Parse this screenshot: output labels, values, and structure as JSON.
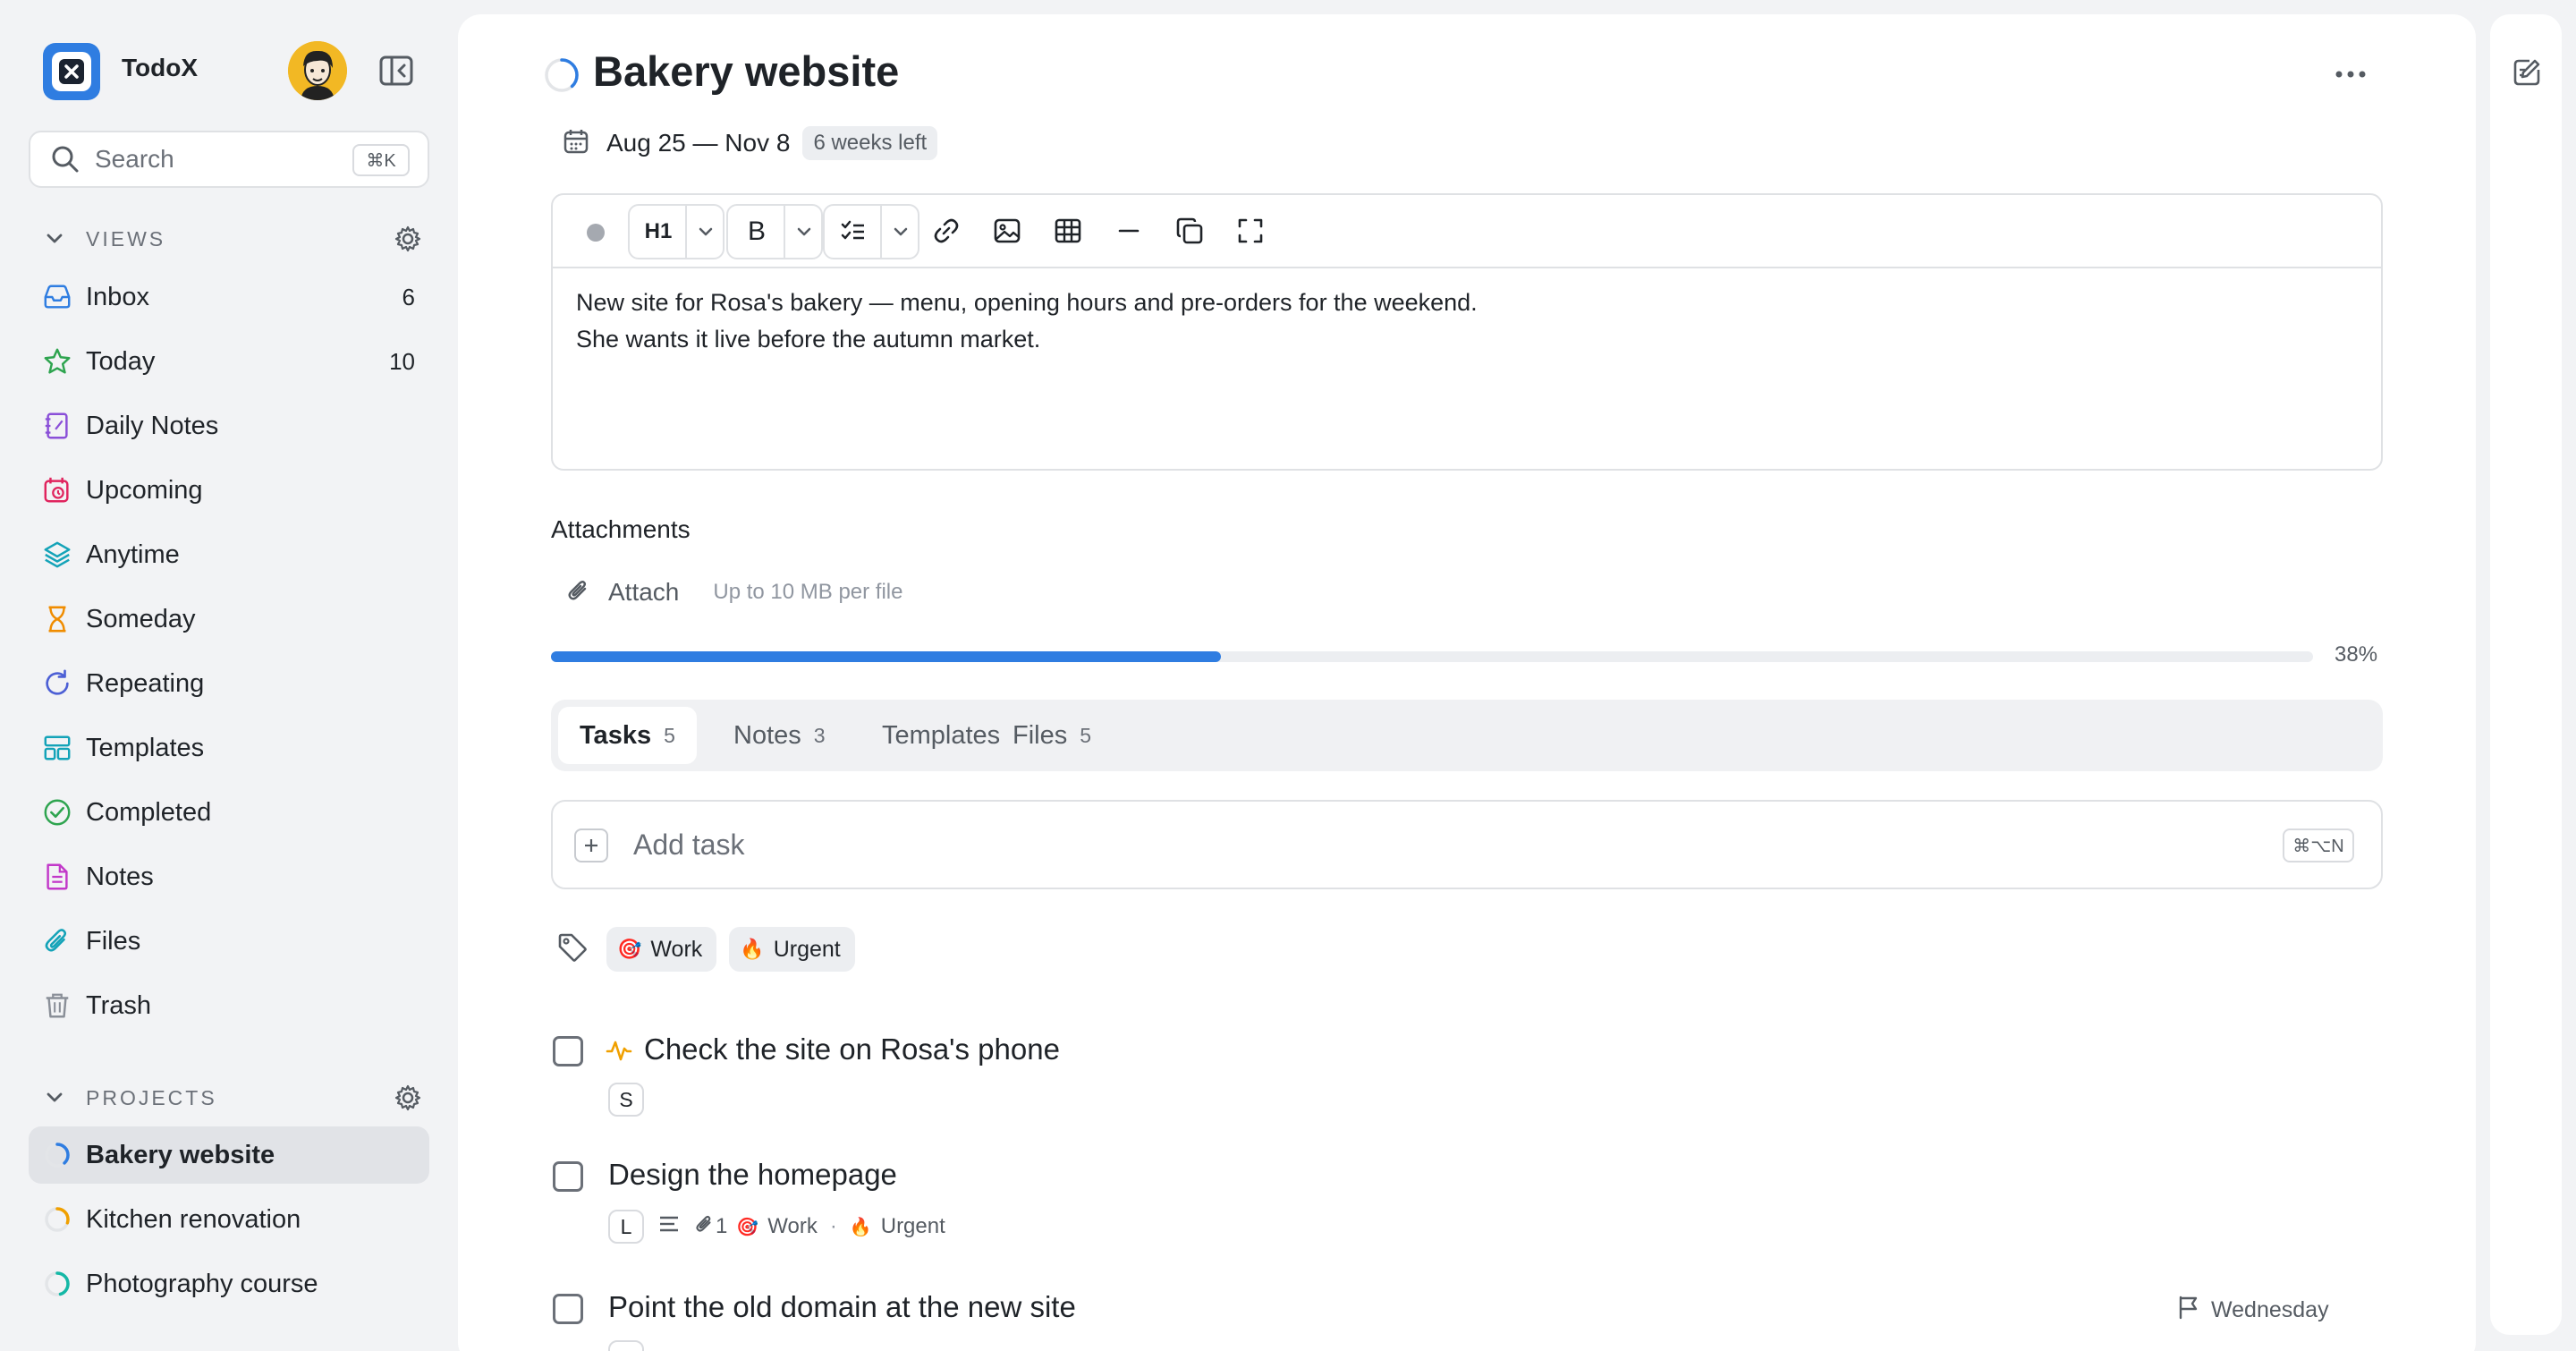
{
  "app": {
    "name": "TodoX"
  },
  "search": {
    "label": "Search",
    "shortcut": "⌘K"
  },
  "views": {
    "header": "VIEWS",
    "items": [
      {
        "label": "Inbox",
        "count": "6",
        "icon": "inbox-icon",
        "color": "#2f7de1"
      },
      {
        "label": "Today",
        "count": "10",
        "icon": "star-icon",
        "color": "#2ea44f"
      },
      {
        "label": "Daily Notes",
        "count": "",
        "icon": "notebook-icon",
        "color": "#8a4fd8"
      },
      {
        "label": "Upcoming",
        "count": "",
        "icon": "calendar-clock-icon",
        "color": "#e0245e"
      },
      {
        "label": "Anytime",
        "count": "",
        "icon": "layers-icon",
        "color": "#14a3b8"
      },
      {
        "label": "Someday",
        "count": "",
        "icon": "hourglass-icon",
        "color": "#f08c00"
      },
      {
        "label": "Repeating",
        "count": "",
        "icon": "repeat-icon",
        "color": "#4c5fd5"
      },
      {
        "label": "Templates",
        "count": "",
        "icon": "template-icon",
        "color": "#14a3b8"
      },
      {
        "label": "Completed",
        "count": "",
        "icon": "check-circle-icon",
        "color": "#2ea44f"
      },
      {
        "label": "Notes",
        "count": "",
        "icon": "note-icon",
        "color": "#c238c9"
      },
      {
        "label": "Files",
        "count": "",
        "icon": "paperclip-icon",
        "color": "#14a3b8"
      },
      {
        "label": "Trash",
        "count": "",
        "icon": "trash-icon",
        "color": "#8a8f98"
      }
    ]
  },
  "projects": {
    "header": "PROJECTS",
    "items": [
      {
        "label": "Bakery website",
        "progress": 0.38,
        "color": "#2f7de1",
        "active": true
      },
      {
        "label": "Kitchen renovation",
        "progress": 0.3,
        "color": "#f0a000",
        "active": false
      },
      {
        "label": "Photography course",
        "progress": 0.45,
        "color": "#14b8a6",
        "active": false
      }
    ]
  },
  "project": {
    "title": "Bakery website",
    "progress": 0.38,
    "date_range": "Aug 25 — Nov 8",
    "time_left": "6 weeks left",
    "toolbar": {
      "heading": "H1",
      "bold": "B"
    },
    "description": [
      "New site for Rosa's bakery — menu, opening hours and pre-orders for the weekend.",
      "She wants it live before the autumn market."
    ]
  },
  "attachments": {
    "title": "Attachments",
    "button": "Attach",
    "hint": "Up to 10 MB per file"
  },
  "progress": {
    "value": 0.38,
    "label": "38%"
  },
  "tabs": [
    {
      "label": "Tasks",
      "count": "5",
      "active": true
    },
    {
      "label": "Notes",
      "count": "3",
      "active": false
    },
    {
      "label": "Templates",
      "count": "",
      "active": false
    },
    {
      "label": "Files",
      "count": "5",
      "active": false
    }
  ],
  "add_task": {
    "label": "Add task",
    "shortcut": "⌘⌥N"
  },
  "tag_filters": [
    {
      "label": "Work",
      "emoji": "🎯"
    },
    {
      "label": "Urgent",
      "emoji": "🔥"
    }
  ],
  "tasks": [
    {
      "title": "Check the site on Rosa's phone",
      "size": "S",
      "activity_icon": true
    },
    {
      "title": "Design the homepage",
      "size": "L",
      "attachments": "1",
      "tags": [
        "Work",
        "Urgent"
      ],
      "tag_emojis": [
        "🎯",
        "🔥"
      ]
    },
    {
      "title": "Point the old domain at the new site",
      "deadline": "Wednesday"
    }
  ]
}
